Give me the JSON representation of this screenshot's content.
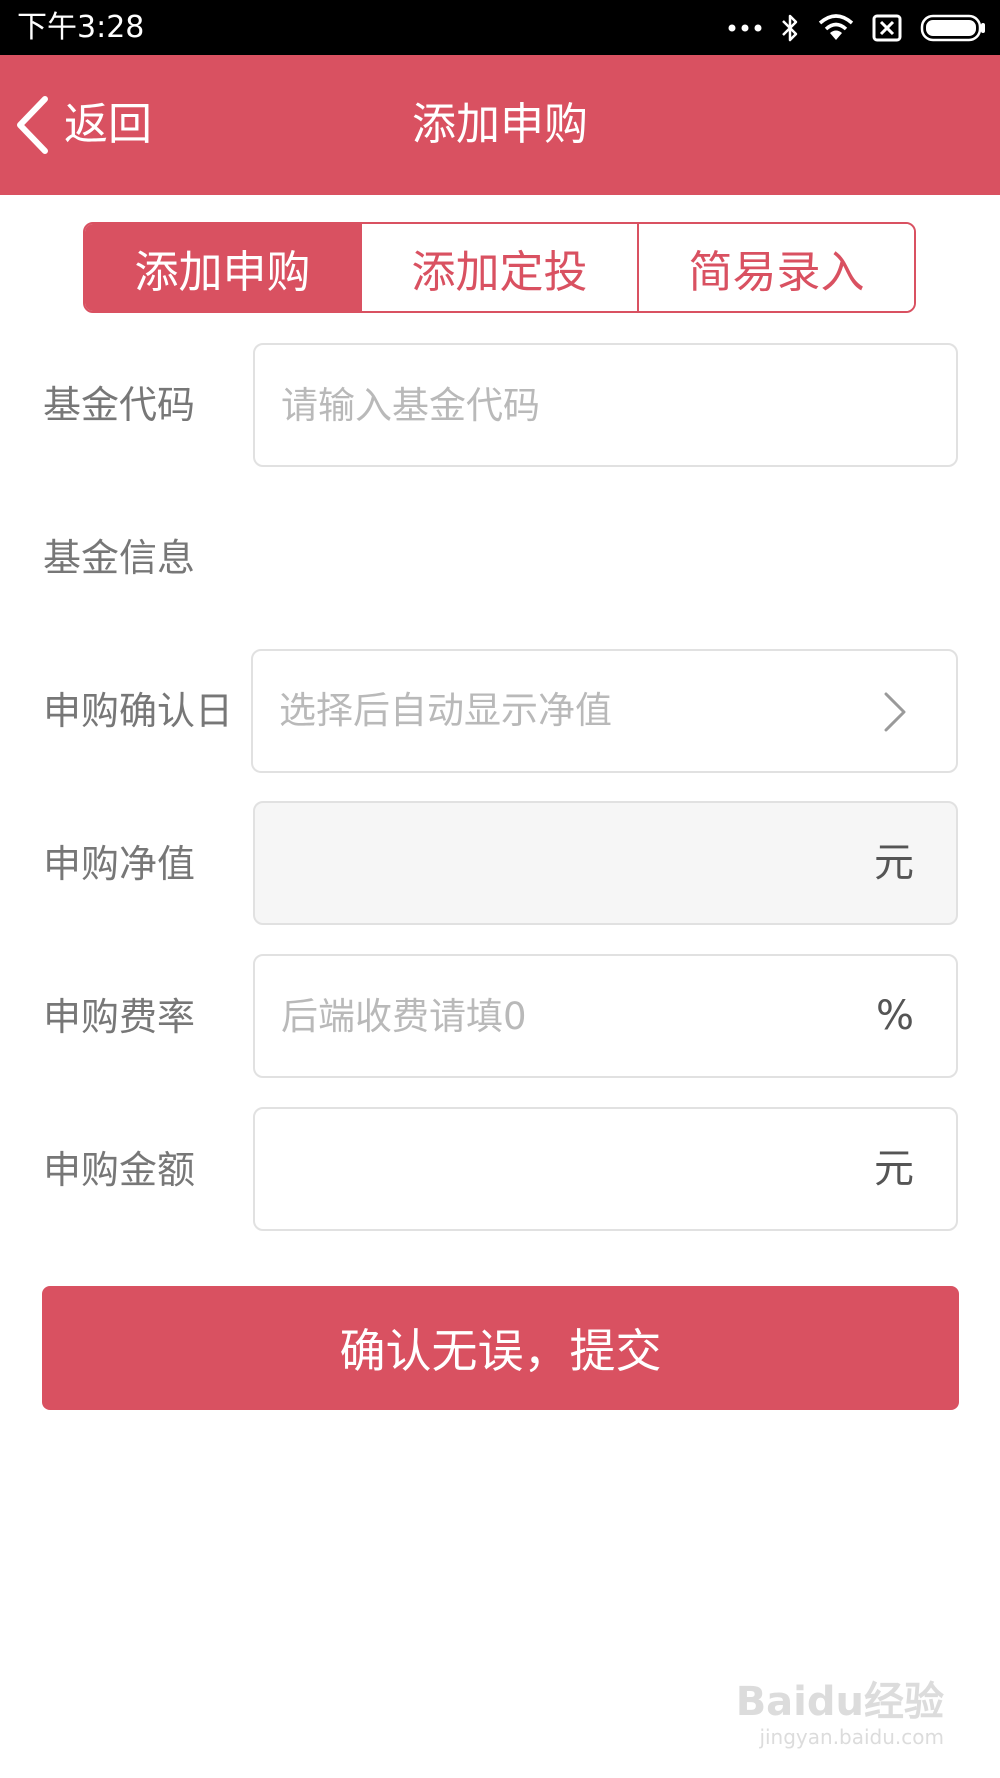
{
  "status_bar": {
    "time": "下午3:28",
    "icons": [
      "more-dots-icon",
      "bluetooth-icon",
      "wifi-icon",
      "sim-off-icon",
      "battery-icon"
    ]
  },
  "header": {
    "back_label": "返回",
    "title": "添加申购"
  },
  "tabs": [
    {
      "label": "添加申购",
      "active": true
    },
    {
      "label": "添加定投",
      "active": false
    },
    {
      "label": "简易录入",
      "active": false
    }
  ],
  "form": {
    "fund_code": {
      "label": "基金代码",
      "value": "",
      "placeholder": "请输入基金代码"
    },
    "fund_info": {
      "label": "基金信息"
    },
    "confirm_date": {
      "label": "申购确认日",
      "placeholder": "选择后自动显示净值"
    },
    "nav": {
      "label": "申购净值",
      "value": "",
      "unit": "元"
    },
    "fee_rate": {
      "label": "申购费率",
      "value": "",
      "placeholder": "后端收费请填0",
      "unit": "%"
    },
    "amount": {
      "label": "申购金额",
      "value": "",
      "unit": "元"
    }
  },
  "submit_label": "确认无误，提交",
  "watermark": {
    "main": "Baidu经验",
    "sub": "jingyan.baidu.com"
  },
  "colors": {
    "accent": "#d95161",
    "status_bar": "#000000",
    "label": "#777777",
    "placeholder": "#b9b9b9",
    "border": "#e1e1e1"
  }
}
